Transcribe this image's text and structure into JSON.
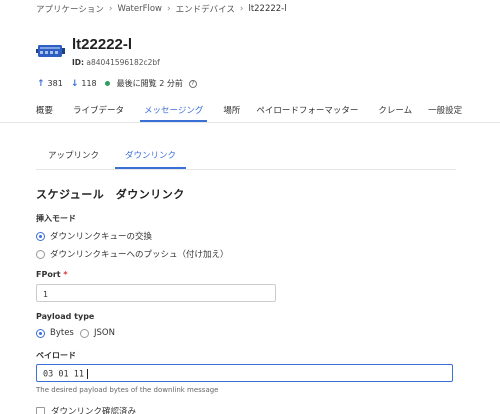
{
  "breadcrumb": {
    "items": [
      "アプリケーション",
      "WaterFlow",
      "エンドデバイス",
      "lt22222-l"
    ]
  },
  "device": {
    "title": "lt22222-l",
    "id_label": "ID:",
    "id_value": "a84041596182c2bf"
  },
  "stats": {
    "up_count": "381",
    "down_count": "118",
    "last_seen": "最後に閲覧 2 分前"
  },
  "tabs": [
    {
      "label": "概要",
      "active": false
    },
    {
      "label": "ライブデータ",
      "active": false
    },
    {
      "label": "メッセージング",
      "active": true
    },
    {
      "label": "場所",
      "active": false
    },
    {
      "label": "ペイロードフォーマッター",
      "active": false
    },
    {
      "label": "クレーム",
      "active": false
    },
    {
      "label": "一般設定",
      "active": false
    }
  ],
  "subtabs": [
    {
      "label": "アップリンク",
      "active": false
    },
    {
      "label": "ダウンリンク",
      "active": true
    }
  ],
  "form": {
    "section_title": "スケジュール　ダウンリンク",
    "insert_mode_label": "挿入モード",
    "insert_mode_options": [
      "ダウンリンクキューの交換",
      "ダウンリンクキューへのプッシュ（付け加え）"
    ],
    "insert_mode_selected": 0,
    "fport_label": "FPort",
    "fport_required": "*",
    "fport_value": "1",
    "payload_type_label": "Payload type",
    "payload_type_options": [
      "Bytes",
      "JSON"
    ],
    "payload_type_selected": 0,
    "payload_label": "ペイロード",
    "payload_value": "03 01 11",
    "payload_helper": "The desired payload bytes of the downlink message",
    "confirm_label": "ダウンリンク確認済み"
  },
  "colors": {
    "accent": "#3a6fd8",
    "status_green": "#2f9e5f",
    "required_red": "#d33333"
  }
}
